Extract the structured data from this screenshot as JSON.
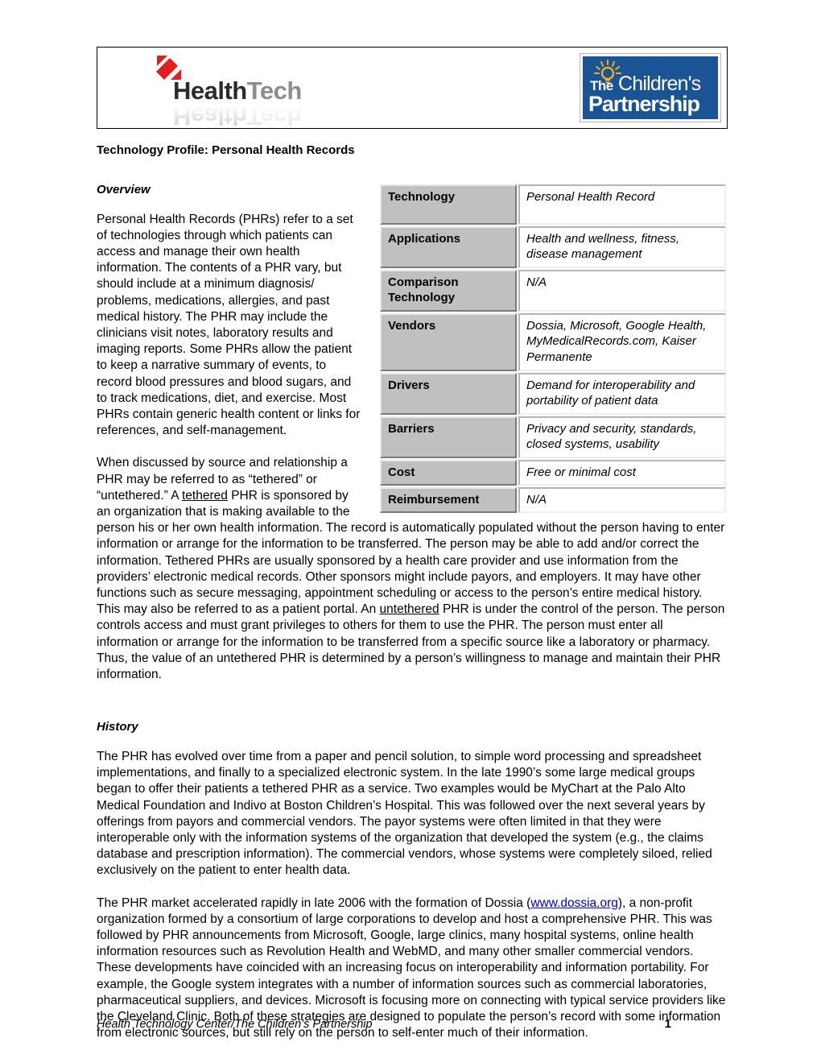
{
  "header": {
    "healthtech_logo": {
      "word_primary": "Health",
      "word_secondary": "Tech",
      "mark": "red-diagonal-slash-icon"
    },
    "childrens_partnership_logo": {
      "line_the": "The",
      "line_childrens": "Children's",
      "line_partnership": "Partnership",
      "bulb": "lightbulb-icon",
      "background_color": "#1a5494",
      "bulb_color": "#f2b01e"
    }
  },
  "document": {
    "title": "Technology Profile: Personal Health Records",
    "sections": {
      "overview_heading": "Overview",
      "history_heading": "History"
    },
    "overview": {
      "p1": "Personal Health Records (PHRs) refer to a set of technologies through which patients can access and manage their own health information.  The contents of a PHR vary, but should include at a minimum diagnosis/ problems, medications, allergies, and past medical history.  The PHR may include the clinicians visit notes, laboratory results and imaging reports.  Some PHRs allow the patient to keep a narrative summary of events, to record blood pressures and blood sugars, and to track medications, diet, and exercise.  Most PHRs contain generic health content or links for references, and self-management.",
      "p2_part1": "When discussed by source and relationship a PHR may be referred to as “tethered” or “untethered.”  A ",
      "p2_link1": "tethered",
      "p2_part2": " PHR is sponsored by an organization that is making available to the person his or her own health information.  The record is automatically populated without the person having to enter information or arrange for the information to be transferred.  The person may be able to add and/or correct the information.  Tethered PHRs are usually sponsored by a health care provider and use information from the providers’ electronic medical records.  Other sponsors might include payors, and employers.   It may have other functions such as secure messaging, appointment scheduling or access to the person’s entire medical history.  This may also be referred to as a patient portal.  An ",
      "p2_link2": "untethered",
      "p2_part3": " PHR is under the control of the person.  The person controls access and must grant privileges to others for them to use the PHR.  The person must enter all information or arrange for the information to be transferred from a specific source like a laboratory or pharmacy.  Thus, the value of an untethered PHR is determined by a person’s willingness to manage and maintain their PHR information."
    },
    "history": {
      "p1": "The PHR has evolved over time from a paper and pencil solution, to simple word processing and spreadsheet implementations, and finally to a specialized electronic system.  In the late 1990’s some large medical groups began to offer their patients a tethered PHR as a service.  Two examples would be MyChart at the Palo Alto Medical Foundation and Indivo at Boston Children’s Hospital. This was followed over the next several years by offerings from payors and commercial vendors. The payor systems were often limited in that they were interoperable only with the information systems of the organization that developed the system (e.g., the claims database and prescription information).  The commercial vendors, whose systems were completely siloed, relied exclusively on the patient to enter health data.",
      "p2_part1": "The PHR market accelerated rapidly in late 2006 with the formation of Dossia (",
      "p2_link": "www.dossia.org",
      "p2_part2": "), a non-profit organization formed by a consortium of large corporations to develop and host a comprehensive PHR.  This was followed by PHR announcements from Microsoft, Google, large clinics, many hospital systems, online health information resources such as Revolution Health and WebMD, and many other smaller commercial vendors.  These developments have coincided with an increasing focus on interoperability and information portability.  For example, the Google system integrates with a number of information sources such as commercial laboratories, pharmaceutical suppliers, and devices.  Microsoft is focusing more on connecting with typical service providers like the Cleveland Clinic.  Both of these strategies are designed to populate the person’s record with some information from electronic sources, but still rely on the person to self-enter much of their information."
    }
  },
  "spec_table": {
    "rows": [
      {
        "label": "Technology",
        "value": "Personal Health Record"
      },
      {
        "label": "Applications",
        "value": "Health and wellness, fitness, disease management"
      },
      {
        "label": "Comparison Technology",
        "value": "N/A"
      },
      {
        "label": "Vendors",
        "value": "Dossia, Microsoft, Google Health, MyMedicalRecords.com, Kaiser Permanente"
      },
      {
        "label": "Drivers",
        "value": "Demand for interoperability and portability of patient data"
      },
      {
        "label": "Barriers",
        "value": "Privacy and security, standards, closed systems, usability"
      },
      {
        "label": "Cost",
        "value": "Free or minimal cost"
      },
      {
        "label": "Reimbursement",
        "value": "N/A"
      }
    ]
  },
  "footer": {
    "text": "Health Technology Center/The Children’s Partnership",
    "page_number": "1"
  }
}
